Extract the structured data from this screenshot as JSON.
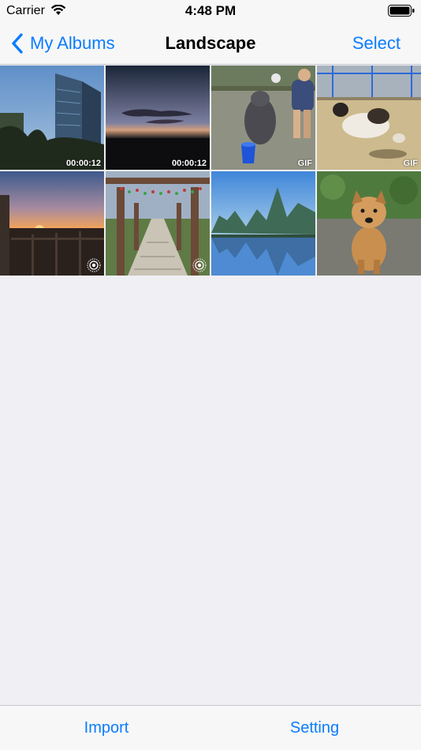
{
  "status_bar": {
    "carrier": "Carrier",
    "time": "4:48 PM"
  },
  "nav": {
    "back_label": "My Albums",
    "title": "Landscape",
    "select_label": "Select"
  },
  "grid": {
    "items": [
      {
        "kind": "video",
        "badge": "00:00:12",
        "subject": "city-building"
      },
      {
        "kind": "video",
        "badge": "00:00:12",
        "subject": "dusk-sky"
      },
      {
        "kind": "gif",
        "badge": "GIF",
        "subject": "pig-and-kid"
      },
      {
        "kind": "gif",
        "badge": "GIF",
        "subject": "dog-playing"
      },
      {
        "kind": "live",
        "badge": "",
        "subject": "sunset"
      },
      {
        "kind": "live",
        "badge": "",
        "subject": "pergola-walkway"
      },
      {
        "kind": "photo",
        "badge": "",
        "subject": "karst-lake"
      },
      {
        "kind": "photo",
        "badge": "",
        "subject": "puppy"
      }
    ]
  },
  "tab_bar": {
    "import_label": "Import",
    "setting_label": "Setting"
  },
  "colors": {
    "accent": "#0a7cff",
    "background": "#efeff4",
    "bar": "#f7f7f7"
  }
}
